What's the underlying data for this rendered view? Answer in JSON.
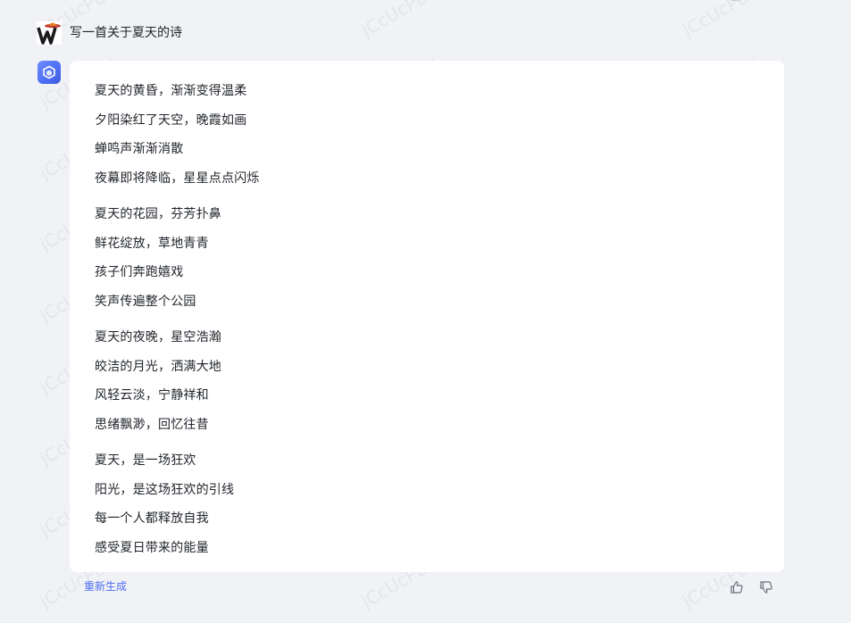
{
  "user": {
    "avatar_icon": "w-letter-cowboy-hat-avatar-icon",
    "prompt": "写一首关于夏天的诗"
  },
  "bot": {
    "avatar_icon": "cube-logo-icon"
  },
  "poem": {
    "stanzas": [
      [
        "夏天的黄昏，渐渐变得温柔",
        "夕阳染红了天空，晚霞如画",
        "蝉鸣声渐渐消散",
        "夜幕即将降临，星星点点闪烁"
      ],
      [
        "夏天的花园，芬芳扑鼻",
        "鲜花绽放，草地青青",
        "孩子们奔跑嬉戏",
        "笑声传遍整个公园"
      ],
      [
        "夏天的夜晚，星空浩瀚",
        "皎洁的月光，洒满大地",
        "风轻云淡，宁静祥和",
        "思绪飘渺，回忆往昔"
      ],
      [
        "夏天，是一场狂欢",
        "阳光，是这场狂欢的引线",
        "每一个人都释放自我",
        "感受夏日带来的能量"
      ]
    ]
  },
  "actions": {
    "regenerate_label": "重新生成",
    "thumbs_up_icon": "thumbs-up-icon",
    "thumbs_down_icon": "thumbs-down-icon"
  },
  "watermark_text": "jCcUcPBv",
  "colors": {
    "page_background": "#f1f2f6",
    "card_background": "#ffffff",
    "accent": "#4e6ef2",
    "text": "#1f2329"
  }
}
